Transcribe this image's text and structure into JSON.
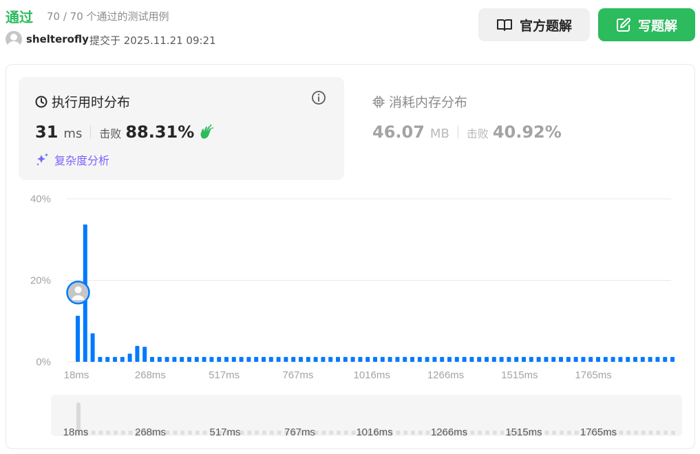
{
  "header": {
    "status": "通过",
    "cases_text": "70 / 70 个通过的测试用例",
    "username": "shelterofly",
    "submitted_text": "提交于 2025.11.21 09:21",
    "official_solution_label": "官方题解",
    "write_solution_label": "写题解"
  },
  "runtime": {
    "title": "执行用时分布",
    "value": "31",
    "unit": "ms",
    "beats_label": "击败",
    "beats_value": "88.31%",
    "complexity_label": "复杂度分析"
  },
  "memory": {
    "title": "消耗内存分布",
    "value": "46.07",
    "unit": "MB",
    "beats_label": "击败",
    "beats_value": "40.92%"
  },
  "colors": {
    "accent_green": "#2cbb5d",
    "bar_blue": "#007aff",
    "mini_bar_gray": "#e0e0e0",
    "complexity_purple": "#7b61ff"
  },
  "chart_data": {
    "type": "bar",
    "x_tick_labels": [
      "18ms",
      "268ms",
      "517ms",
      "767ms",
      "1016ms",
      "1266ms",
      "1515ms",
      "1765ms"
    ],
    "y_tick_labels": [
      "40%",
      "20%",
      "0%"
    ],
    "ylim": [
      0,
      40
    ],
    "values": [
      11.3,
      33.7,
      7.0,
      1.2,
      1.2,
      1.2,
      1.2,
      2.0,
      3.9,
      3.7,
      1.2,
      1.2,
      1.2,
      1.2,
      1.2,
      1.2,
      1.2,
      1.2,
      1.2,
      1.2,
      1.2,
      1.2,
      1.2,
      1.2,
      1.2,
      1.2,
      1.2,
      1.2,
      1.2,
      1.2,
      1.2,
      1.2,
      1.2,
      1.2,
      1.2,
      1.2,
      1.2,
      1.2,
      1.2,
      1.2,
      1.2,
      1.2,
      1.2,
      1.2,
      1.2,
      1.2,
      1.2,
      1.2,
      1.2,
      1.2,
      1.2,
      1.2,
      1.2,
      1.2,
      1.2,
      1.2,
      1.2,
      1.2,
      1.2,
      1.2,
      1.2,
      1.2,
      1.2,
      1.2,
      1.2,
      1.2,
      1.2,
      1.2,
      1.2,
      1.2,
      1.2,
      1.2,
      1.2,
      1.2,
      1.2,
      1.2,
      1.2,
      1.2,
      1.2,
      1.2,
      1.2
    ],
    "marker_bar_index": 0,
    "marker_value": 17
  }
}
